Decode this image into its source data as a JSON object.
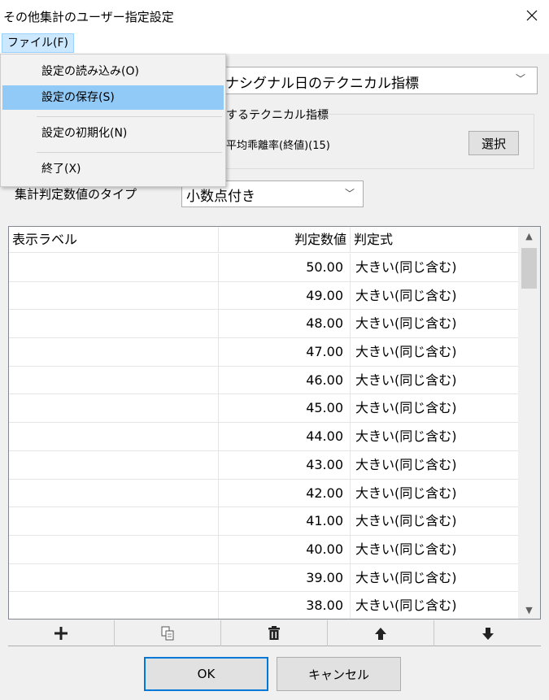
{
  "window": {
    "title": "その他集計のユーザー指定設定",
    "close_glyph": "✕"
  },
  "menubar": {
    "file_label": "ファイル(F)"
  },
  "file_menu": {
    "items": [
      {
        "label": "設定の読み込み(O)"
      },
      {
        "label": "設定の保存(S)",
        "highlighted": true
      },
      {
        "label": "設定の初期化(N)"
      },
      {
        "label": "終了(X)"
      }
    ]
  },
  "signal": {
    "selected": "ナシグナル日のテクニカル指標"
  },
  "tech_group": {
    "label": "するテクニカル指標",
    "value": "平均乖離率(終値)(15)",
    "select_button": "選択"
  },
  "type_row": {
    "label": "集計判定数値のタイプ",
    "selected": "小数点付き"
  },
  "table": {
    "columns": [
      "表示ラベル",
      "判定数値",
      "判定式"
    ],
    "rows": [
      {
        "label": "",
        "value": "50.00",
        "formula": "大きい(同じ含む)"
      },
      {
        "label": "",
        "value": "49.00",
        "formula": "大きい(同じ含む)"
      },
      {
        "label": "",
        "value": "48.00",
        "formula": "大きい(同じ含む)"
      },
      {
        "label": "",
        "value": "47.00",
        "formula": "大きい(同じ含む)"
      },
      {
        "label": "",
        "value": "46.00",
        "formula": "大きい(同じ含む)"
      },
      {
        "label": "",
        "value": "45.00",
        "formula": "大きい(同じ含む)"
      },
      {
        "label": "",
        "value": "44.00",
        "formula": "大きい(同じ含む)"
      },
      {
        "label": "",
        "value": "43.00",
        "formula": "大きい(同じ含む)"
      },
      {
        "label": "",
        "value": "42.00",
        "formula": "大きい(同じ含む)"
      },
      {
        "label": "",
        "value": "41.00",
        "formula": "大きい(同じ含む)"
      },
      {
        "label": "",
        "value": "40.00",
        "formula": "大きい(同じ含む)"
      },
      {
        "label": "",
        "value": "39.00",
        "formula": "大きい(同じ含む)"
      },
      {
        "label": "",
        "value": "38.00",
        "formula": "大きい(同じ含む)"
      }
    ]
  },
  "toolbar": {
    "icons": [
      "plus-icon",
      "copy-icon",
      "trash-icon",
      "arrow-up-icon",
      "arrow-down-icon"
    ]
  },
  "footer": {
    "ok_label": "OK",
    "cancel_label": "キャンセル"
  },
  "colors": {
    "menu_highlight": "#91c9f7",
    "menubar_active": "#cce8ff",
    "focus_border": "#0078d7"
  }
}
